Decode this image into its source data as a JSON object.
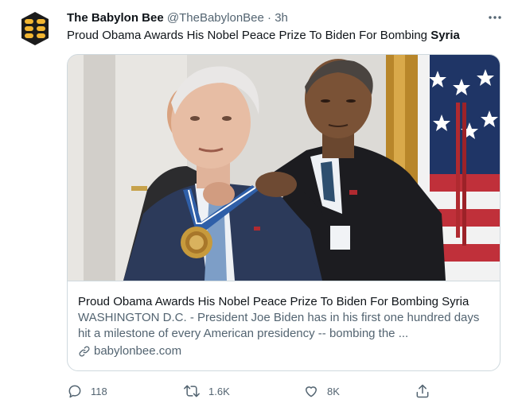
{
  "tweet": {
    "author_name": "The Babylon Bee",
    "handle": "@TheBabylonBee",
    "separator": "·",
    "time": "3h",
    "text_prefix": "Proud Obama Awards His Nobel Peace Prize To Biden For Bombing ",
    "text_bold": "Syria"
  },
  "card": {
    "title": "Proud Obama Awards His Nobel Peace Prize To Biden For Bombing Syria",
    "description": "WASHINGTON D.C. - President Joe Biden has in his first one hundred days hit a milestone of every American presidency -- bombing the ...",
    "domain": "babylonbee.com"
  },
  "actions": {
    "replies": "118",
    "retweets": "1.6K",
    "likes": "8K"
  },
  "icons": {
    "more": "more-icon",
    "reply": "reply-icon",
    "retweet": "retweet-icon",
    "like": "heart-icon",
    "share": "share-icon",
    "link": "link-icon"
  },
  "colors": {
    "text": "#0f1419",
    "secondary": "#536471",
    "border": "#cfd9de",
    "logo_yellow": "#f2b632"
  }
}
